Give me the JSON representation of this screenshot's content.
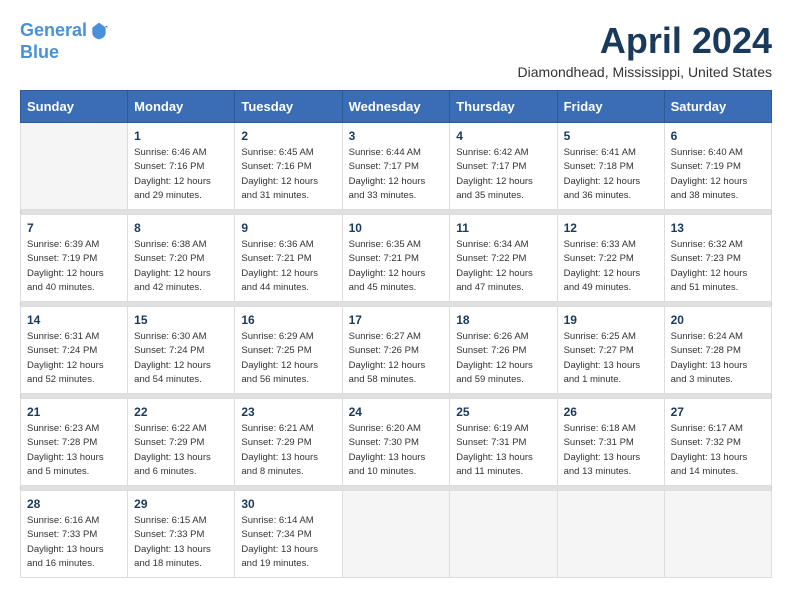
{
  "logo": {
    "line1": "General",
    "line2": "Blue"
  },
  "title": "April 2024",
  "location": "Diamondhead, Mississippi, United States",
  "weekdays": [
    "Sunday",
    "Monday",
    "Tuesday",
    "Wednesday",
    "Thursday",
    "Friday",
    "Saturday"
  ],
  "weeks": [
    [
      {
        "day": "",
        "info": ""
      },
      {
        "day": "1",
        "info": "Sunrise: 6:46 AM\nSunset: 7:16 PM\nDaylight: 12 hours\nand 29 minutes."
      },
      {
        "day": "2",
        "info": "Sunrise: 6:45 AM\nSunset: 7:16 PM\nDaylight: 12 hours\nand 31 minutes."
      },
      {
        "day": "3",
        "info": "Sunrise: 6:44 AM\nSunset: 7:17 PM\nDaylight: 12 hours\nand 33 minutes."
      },
      {
        "day": "4",
        "info": "Sunrise: 6:42 AM\nSunset: 7:17 PM\nDaylight: 12 hours\nand 35 minutes."
      },
      {
        "day": "5",
        "info": "Sunrise: 6:41 AM\nSunset: 7:18 PM\nDaylight: 12 hours\nand 36 minutes."
      },
      {
        "day": "6",
        "info": "Sunrise: 6:40 AM\nSunset: 7:19 PM\nDaylight: 12 hours\nand 38 minutes."
      }
    ],
    [
      {
        "day": "7",
        "info": "Sunrise: 6:39 AM\nSunset: 7:19 PM\nDaylight: 12 hours\nand 40 minutes."
      },
      {
        "day": "8",
        "info": "Sunrise: 6:38 AM\nSunset: 7:20 PM\nDaylight: 12 hours\nand 42 minutes."
      },
      {
        "day": "9",
        "info": "Sunrise: 6:36 AM\nSunset: 7:21 PM\nDaylight: 12 hours\nand 44 minutes."
      },
      {
        "day": "10",
        "info": "Sunrise: 6:35 AM\nSunset: 7:21 PM\nDaylight: 12 hours\nand 45 minutes."
      },
      {
        "day": "11",
        "info": "Sunrise: 6:34 AM\nSunset: 7:22 PM\nDaylight: 12 hours\nand 47 minutes."
      },
      {
        "day": "12",
        "info": "Sunrise: 6:33 AM\nSunset: 7:22 PM\nDaylight: 12 hours\nand 49 minutes."
      },
      {
        "day": "13",
        "info": "Sunrise: 6:32 AM\nSunset: 7:23 PM\nDaylight: 12 hours\nand 51 minutes."
      }
    ],
    [
      {
        "day": "14",
        "info": "Sunrise: 6:31 AM\nSunset: 7:24 PM\nDaylight: 12 hours\nand 52 minutes."
      },
      {
        "day": "15",
        "info": "Sunrise: 6:30 AM\nSunset: 7:24 PM\nDaylight: 12 hours\nand 54 minutes."
      },
      {
        "day": "16",
        "info": "Sunrise: 6:29 AM\nSunset: 7:25 PM\nDaylight: 12 hours\nand 56 minutes."
      },
      {
        "day": "17",
        "info": "Sunrise: 6:27 AM\nSunset: 7:26 PM\nDaylight: 12 hours\nand 58 minutes."
      },
      {
        "day": "18",
        "info": "Sunrise: 6:26 AM\nSunset: 7:26 PM\nDaylight: 12 hours\nand 59 minutes."
      },
      {
        "day": "19",
        "info": "Sunrise: 6:25 AM\nSunset: 7:27 PM\nDaylight: 13 hours\nand 1 minute."
      },
      {
        "day": "20",
        "info": "Sunrise: 6:24 AM\nSunset: 7:28 PM\nDaylight: 13 hours\nand 3 minutes."
      }
    ],
    [
      {
        "day": "21",
        "info": "Sunrise: 6:23 AM\nSunset: 7:28 PM\nDaylight: 13 hours\nand 5 minutes."
      },
      {
        "day": "22",
        "info": "Sunrise: 6:22 AM\nSunset: 7:29 PM\nDaylight: 13 hours\nand 6 minutes."
      },
      {
        "day": "23",
        "info": "Sunrise: 6:21 AM\nSunset: 7:29 PM\nDaylight: 13 hours\nand 8 minutes."
      },
      {
        "day": "24",
        "info": "Sunrise: 6:20 AM\nSunset: 7:30 PM\nDaylight: 13 hours\nand 10 minutes."
      },
      {
        "day": "25",
        "info": "Sunrise: 6:19 AM\nSunset: 7:31 PM\nDaylight: 13 hours\nand 11 minutes."
      },
      {
        "day": "26",
        "info": "Sunrise: 6:18 AM\nSunset: 7:31 PM\nDaylight: 13 hours\nand 13 minutes."
      },
      {
        "day": "27",
        "info": "Sunrise: 6:17 AM\nSunset: 7:32 PM\nDaylight: 13 hours\nand 14 minutes."
      }
    ],
    [
      {
        "day": "28",
        "info": "Sunrise: 6:16 AM\nSunset: 7:33 PM\nDaylight: 13 hours\nand 16 minutes."
      },
      {
        "day": "29",
        "info": "Sunrise: 6:15 AM\nSunset: 7:33 PM\nDaylight: 13 hours\nand 18 minutes."
      },
      {
        "day": "30",
        "info": "Sunrise: 6:14 AM\nSunset: 7:34 PM\nDaylight: 13 hours\nand 19 minutes."
      },
      {
        "day": "",
        "info": ""
      },
      {
        "day": "",
        "info": ""
      },
      {
        "day": "",
        "info": ""
      },
      {
        "day": "",
        "info": ""
      }
    ]
  ]
}
